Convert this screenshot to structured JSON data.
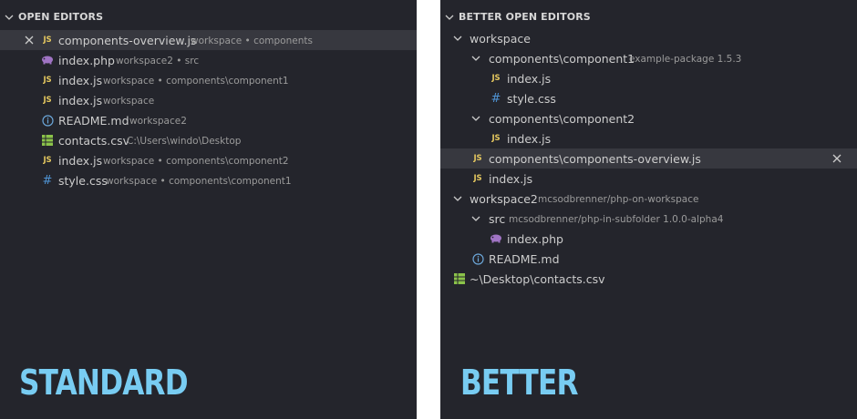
{
  "standard": {
    "header": "OPEN EDITORS",
    "items": [
      {
        "name": "components-overview.js",
        "desc": "workspace • components",
        "icon": "js-icon",
        "selected": true
      },
      {
        "name": "index.php",
        "desc": "workspace2 • src",
        "icon": "php-icon"
      },
      {
        "name": "index.js",
        "desc": "workspace • components\\component1",
        "icon": "js-icon"
      },
      {
        "name": "index.js",
        "desc": "workspace",
        "icon": "js-icon"
      },
      {
        "name": "README.md",
        "desc": "workspace2",
        "icon": "info-icon"
      },
      {
        "name": "contacts.csv",
        "desc": "C:\\Users\\windo\\Desktop",
        "icon": "csv-table-icon"
      },
      {
        "name": "index.js",
        "desc": "workspace • components\\component2",
        "icon": "js-icon"
      },
      {
        "name": "style.css",
        "desc": "workspace • components\\component1",
        "icon": "css-hash-icon"
      }
    ],
    "label": "STANDARD"
  },
  "better": {
    "header": "BETTER OPEN EDITORS",
    "tree": [
      {
        "name": "workspace",
        "desc": ""
      },
      {
        "name": "components\\component1",
        "desc": "example-package 1.5.3"
      },
      {
        "name": "index.js",
        "desc": ""
      },
      {
        "name": "style.css",
        "desc": ""
      },
      {
        "name": "components\\component2",
        "desc": ""
      },
      {
        "name": "index.js",
        "desc": ""
      },
      {
        "name": "components\\components-overview.js",
        "desc": ""
      },
      {
        "name": "index.js",
        "desc": ""
      },
      {
        "name": "workspace2",
        "desc": "mcsodbrenner/php-on-workspace"
      },
      {
        "name": "src",
        "desc": "mcsodbrenner/php-in-subfolder 1.0.0-alpha4"
      },
      {
        "name": "index.php",
        "desc": ""
      },
      {
        "name": "README.md",
        "desc": ""
      },
      {
        "name": "~\\Desktop\\contacts.csv",
        "desc": ""
      }
    ],
    "label": "BETTER"
  },
  "icon_glyphs": {
    "js": "JS",
    "css": "#"
  },
  "colors": {
    "panel_bg": "#24252c",
    "selected_bg": "#37383f",
    "js_yellow": "#e5c85f",
    "css_blue": "#4f94d4",
    "php_purple": "#a074c4",
    "csv_green": "#8bc34a",
    "info_blue": "#6ba6d8",
    "label_blue": "#78ccf2"
  }
}
